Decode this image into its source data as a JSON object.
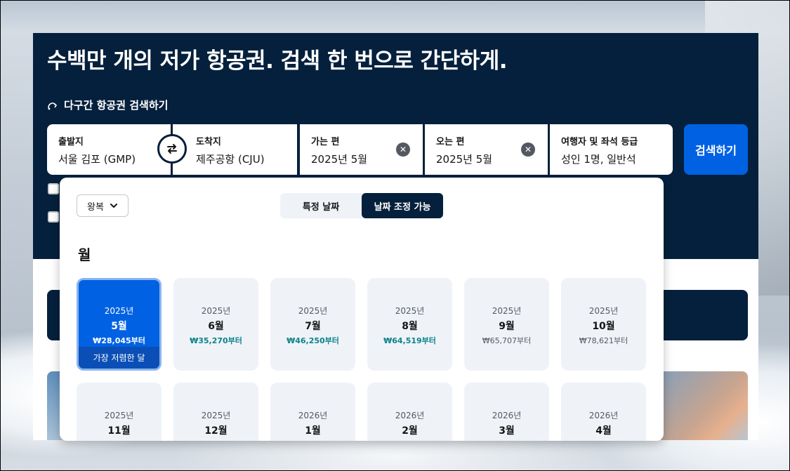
{
  "hero": {
    "headline": "수백만 개의 저가 항공권. 검색 한 번으로 간단하게.",
    "multi_city_label": "다구간 항공권 검색하기"
  },
  "search": {
    "origin_label": "출발지",
    "origin_value": "서울 김포 (GMP)",
    "destination_label": "도착지",
    "destination_value": "제주공항 (CJU)",
    "depart_label": "가는 편",
    "depart_value": "2025년 5월",
    "return_label": "오는 편",
    "return_value": "2025년 5월",
    "travellers_label": "여행자 및 좌석 등급",
    "travellers_value": "성인 1명, 일반석",
    "search_button": "검색하기"
  },
  "date_panel": {
    "trip_type": "왕복",
    "tabs": [
      {
        "label": "특정 날짜",
        "active": false
      },
      {
        "label": "날짜 조정 가능",
        "active": true
      }
    ],
    "section_title": "월",
    "months": [
      {
        "year": "2025년",
        "month": "5월",
        "price": "₩28,045부터",
        "selected": true,
        "badge": "가장 저렴한 달",
        "highlight": false
      },
      {
        "year": "2025년",
        "month": "6월",
        "price": "₩35,270부터",
        "selected": false,
        "highlight": true
      },
      {
        "year": "2025년",
        "month": "7월",
        "price": "₩46,250부터",
        "selected": false,
        "highlight": true
      },
      {
        "year": "2025년",
        "month": "8월",
        "price": "₩64,519부터",
        "selected": false,
        "highlight": true
      },
      {
        "year": "2025년",
        "month": "9월",
        "price": "₩65,707부터",
        "selected": false,
        "highlight": false
      },
      {
        "year": "2025년",
        "month": "10월",
        "price": "₩78,621부터",
        "selected": false,
        "highlight": false
      },
      {
        "year": "2025년",
        "month": "11월",
        "price": "",
        "selected": false,
        "highlight": false
      },
      {
        "year": "2025년",
        "month": "12월",
        "price": "",
        "selected": false,
        "highlight": false
      },
      {
        "year": "2026년",
        "month": "1월",
        "price": "",
        "selected": false,
        "highlight": false
      },
      {
        "year": "2026년",
        "month": "2월",
        "price": "",
        "selected": false,
        "highlight": false
      },
      {
        "year": "2026년",
        "month": "3월",
        "price": "",
        "selected": false,
        "highlight": false
      },
      {
        "year": "2026년",
        "month": "4월",
        "price": "",
        "selected": false,
        "highlight": false
      }
    ]
  },
  "colors": {
    "header_bg": "#05203c",
    "accent": "#0062e3",
    "price_green": "#0c838a"
  }
}
